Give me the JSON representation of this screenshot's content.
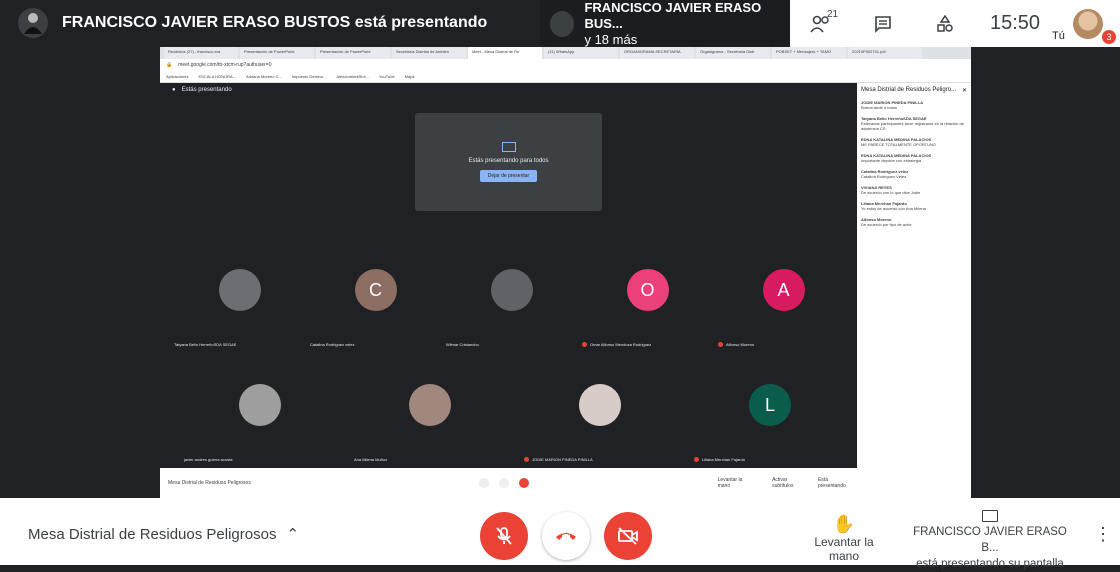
{
  "top": {
    "presenter_text": "FRANCISCO JAVIER ERASO BUSTOS está presentando",
    "tile_name": "FRANCISCO JAVIER ERASO BUS...",
    "tile_more": "y 18 más",
    "participants_count": "21",
    "time": "15:50",
    "you_label": "Tú",
    "badge": "3"
  },
  "inner": {
    "tabs": [
      "Recibidos (27) - francisco.era",
      "Presentación de PowerPoint",
      "Presentación de PowerPoint",
      "Secretaría Distrital de Ambien",
      "Meet - Mesa Distrial de Re",
      "(11) WhatsApp",
      "ORGANIGRAMA SECRETARÍA",
      "Organigrama - Secretaria Distr",
      "POBSET + Mensajero + TAMO",
      "20210F902741.pdf"
    ],
    "url": "meet.google.com/ttr-xtcm-rup?authuser=0",
    "bookmarks": [
      "Aplicaciones",
      "ESCALA HONORA...",
      "Adriana Moreno C...",
      "Impuesto Destino...",
      "Aleo/cotrientRiot...",
      "YouTube",
      "Maps"
    ],
    "presenting_label": "Estás presentando",
    "present_card_text": "Estás presentando para todos",
    "stop_button": "Dejar de presentar",
    "meeting_name": "Mesa Distrial de Residuos Peligrosos",
    "raise_hand": "Levantar la mano",
    "subtitles": "Activar subtítulos",
    "presenting": "Está presentando"
  },
  "participants": [
    {
      "name": "Tatyana Bello HerreñoSDA SEGAE",
      "initial": "",
      "color": "#5f6368"
    },
    {
      "name": "Catalina Rodriguez velez",
      "initial": "C",
      "color": "#8d6e63"
    },
    {
      "name": "Wilmar Cristancho",
      "initial": "",
      "color": "#5f6368"
    },
    {
      "name": "Omar Alfonso Mendoza Rodriguez",
      "initial": "O",
      "color": "#ec407a"
    },
    {
      "name": "Alfonso Moreno",
      "initial": "A",
      "color": "#d81b60"
    },
    {
      "name": "javier andres guerra acosta",
      "initial": "",
      "color": "#9e9e9e"
    },
    {
      "name": "Ana Milena Muñoz",
      "initial": "",
      "color": "#a1887f"
    },
    {
      "name": "JODIE MARION PINEDA PINILLA",
      "initial": "",
      "color": "#d7ccc8"
    },
    {
      "name": "Liliana Merchan Fajardo",
      "initial": "L",
      "color": "#0b5d4b"
    }
  ],
  "chat": {
    "title": "Mesa Distrial de Residuos Peligro...",
    "messages": [
      {
        "sender": "JODIE MARION PINEDA PINILLA",
        "text": "Buena tarde a todos"
      },
      {
        "sender": "Tatyana Bello HerreñoSDA SEGAE",
        "text": "Estimados participantes favor registrarse en la relación de asistencia CS:"
      },
      {
        "sender": "EDNA KATALINA MEDINA PALACIOS",
        "text": "ME PARECE TOTALMENTE OPORTUNO"
      },
      {
        "sender": "EDNA KATALINA MEDINA PALACIOS",
        "text": "Importante deporte con estrategia"
      },
      {
        "sender": "Catalina Rodriguez velez",
        "text": "Catalina Rodriguez Vélez"
      },
      {
        "sender": "VIVIANA REYES",
        "text": "De acuerdo con lo que dice Jodie"
      },
      {
        "sender": "Liliana Merchan Fajardo",
        "text": "Yo estoy de acuerdo con Ana Milena"
      },
      {
        "sender": "Alfonso Moreno",
        "text": "De acuerdo por tipo de actor"
      }
    ]
  },
  "bottom": {
    "meeting_name": "Mesa Distrial de Residuos Peligrosos",
    "raise_hand": "Levantar la mano",
    "presenter_line1": "FRANCISCO JAVIER ERASO B...",
    "presenter_line2": "está presentando su pantalla"
  }
}
